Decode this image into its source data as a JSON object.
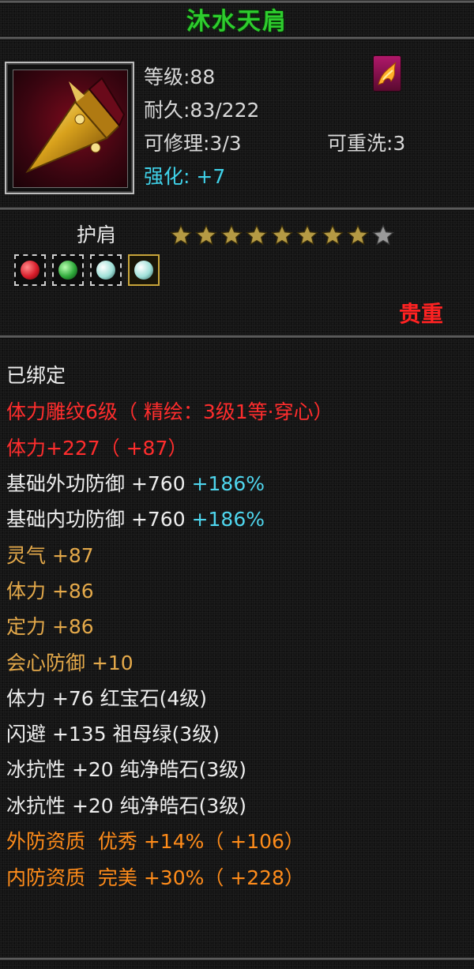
{
  "title": "沐水天肩",
  "item": {
    "icon": "golden-shoulder-armor-icon",
    "level": "等级:88",
    "durability": "耐久:83/222",
    "repairable": "可修理:3/3",
    "rewash": "可重洗:3",
    "enhance": "强化: +7",
    "type_name": "护肩",
    "stars_filled": 8,
    "stars_total": 9,
    "gems": [
      {
        "icon": "ruby-gem-icon",
        "color": "#d81c2a"
      },
      {
        "icon": "emerald-gem-icon",
        "color": "#2ea83a"
      },
      {
        "icon": "pure-white-stone-icon",
        "color": "#9fe0d8"
      },
      {
        "icon": "pure-white-stone-icon",
        "color": "#9fe0d8"
      }
    ],
    "rarity": "贵重"
  },
  "attributes": {
    "bound": "已绑定",
    "engrave": "体力雕纹6级（ 精绘：3级1等·穿心）",
    "stamina_bonus": "体力+227（ +87）",
    "outer_def_label": "基础外功防御 +760",
    "outer_def_pct": "+186%",
    "inner_def_label": "基础内功防御 +760",
    "inner_def_pct": "+186%",
    "spirit": "灵气 +87",
    "stamina": "体力 +86",
    "focus": "定力 +86",
    "crit_def": "会心防御 +10",
    "gem1": "体力 +76 红宝石(4级)",
    "gem2": "闪避 +135 祖母绿(3级)",
    "gem3": "冰抗性 +20 纯净皓石(3级)",
    "gem4": "冰抗性 +20 纯净皓石(3级)",
    "outer_quality": "外防资质  优秀 +14%（ +106）",
    "inner_quality": "内防资质  完美 +30%（ +228）"
  },
  "colors": {
    "title": "#2ecc2e",
    "red": "#ff2d2d",
    "gold": "#e4a94a",
    "cyan": "#4fd6ee",
    "orange": "#ff8c1a"
  }
}
